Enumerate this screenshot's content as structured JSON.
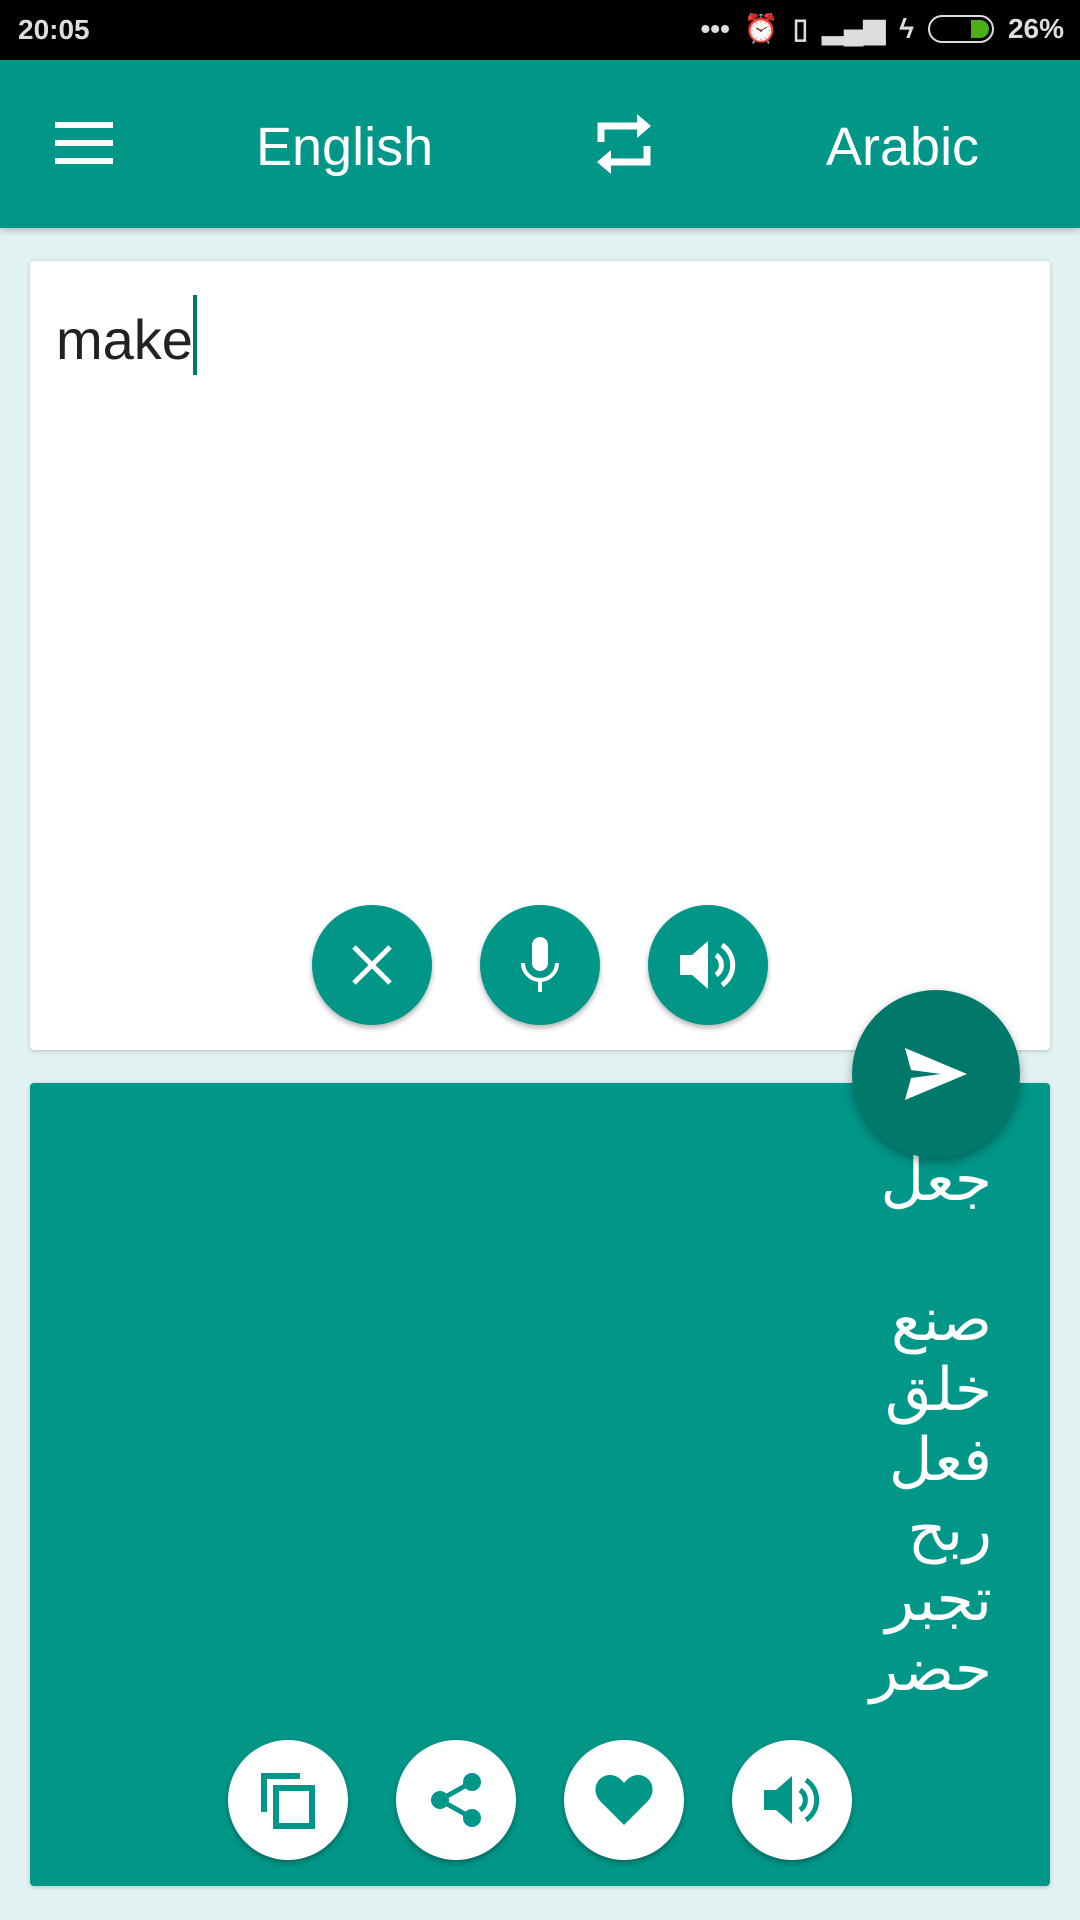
{
  "status": {
    "time": "20:05",
    "battery": "26%",
    "battery_level": 26
  },
  "toolbar": {
    "source_lang": "English",
    "target_lang": "Arabic"
  },
  "input": {
    "text": "make"
  },
  "output": {
    "lines": [
      "جعل",
      "",
      "صنع",
      "خلق",
      "فعل",
      "ربح",
      "تجبر",
      "حضر"
    ]
  },
  "colors": {
    "primary": "#009688",
    "dark": "#00796b",
    "background": "#e0f2f1"
  },
  "icons": {
    "clear": "close-icon",
    "mic": "microphone-icon",
    "speak": "speaker-icon",
    "send": "send-icon",
    "copy": "copy-icon",
    "share": "share-icon",
    "favorite": "heart-icon"
  }
}
